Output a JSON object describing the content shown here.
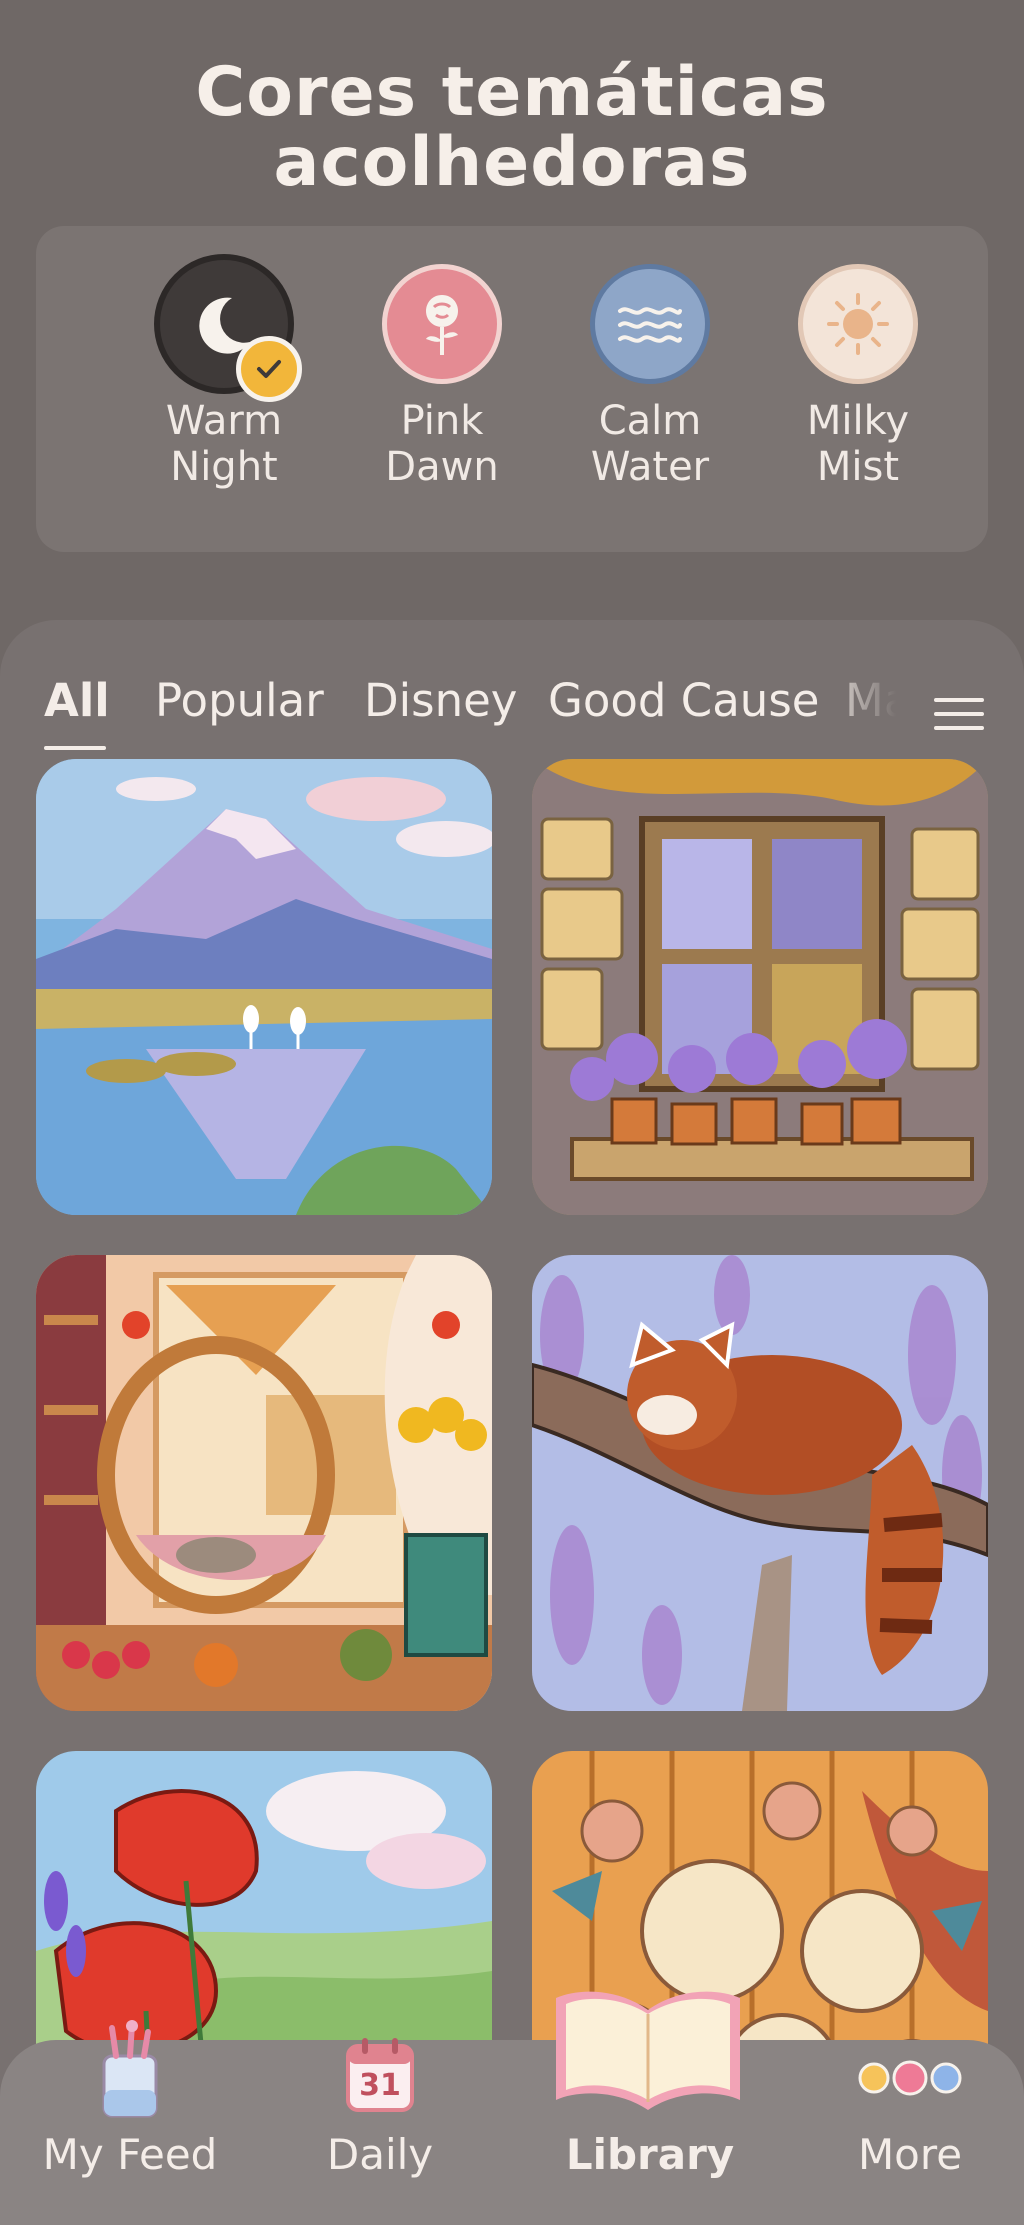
{
  "header": {
    "title_line1": "Cores temáticas",
    "title_line2": "acolhedoras"
  },
  "themes": [
    {
      "label_line1": "Warm",
      "label_line2": "Night",
      "icon": "moon-icon",
      "color": "#3f3a39",
      "selected": true
    },
    {
      "label_line1": "Pink",
      "label_line2": "Dawn",
      "icon": "rose-icon",
      "color": "#e48b93"
    },
    {
      "label_line1": "Calm",
      "label_line2": "Water",
      "icon": "waves-icon",
      "color": "#8ea6c8"
    },
    {
      "label_line1": "Milky",
      "label_line2": "Mist",
      "icon": "sun-icon",
      "color": "#f3e4d8"
    }
  ],
  "tabs": [
    {
      "label": "All",
      "active": true
    },
    {
      "label": "Popular"
    },
    {
      "label": "Disney"
    },
    {
      "label": "Good Cause"
    },
    {
      "label": "Ma"
    }
  ],
  "cards": [
    {
      "subject": "mountain-lake"
    },
    {
      "subject": "window-flowers"
    },
    {
      "subject": "hanging-chair"
    },
    {
      "subject": "red-panda"
    },
    {
      "subject": "poppies"
    },
    {
      "subject": "chrysanthemums"
    }
  ],
  "nav": [
    {
      "label": "My Feed",
      "icon": "brush-cup-icon"
    },
    {
      "label": "Daily",
      "icon": "calendar-icon",
      "calendar_day": "31"
    },
    {
      "label": "Library",
      "icon": "book-icon",
      "active": true
    },
    {
      "label": "More",
      "icon": "dots-icon"
    }
  ],
  "colors": {
    "background": "#6f6866",
    "panel": "#7b7472",
    "nav": "#8a8483",
    "check": "#f2b63a"
  }
}
